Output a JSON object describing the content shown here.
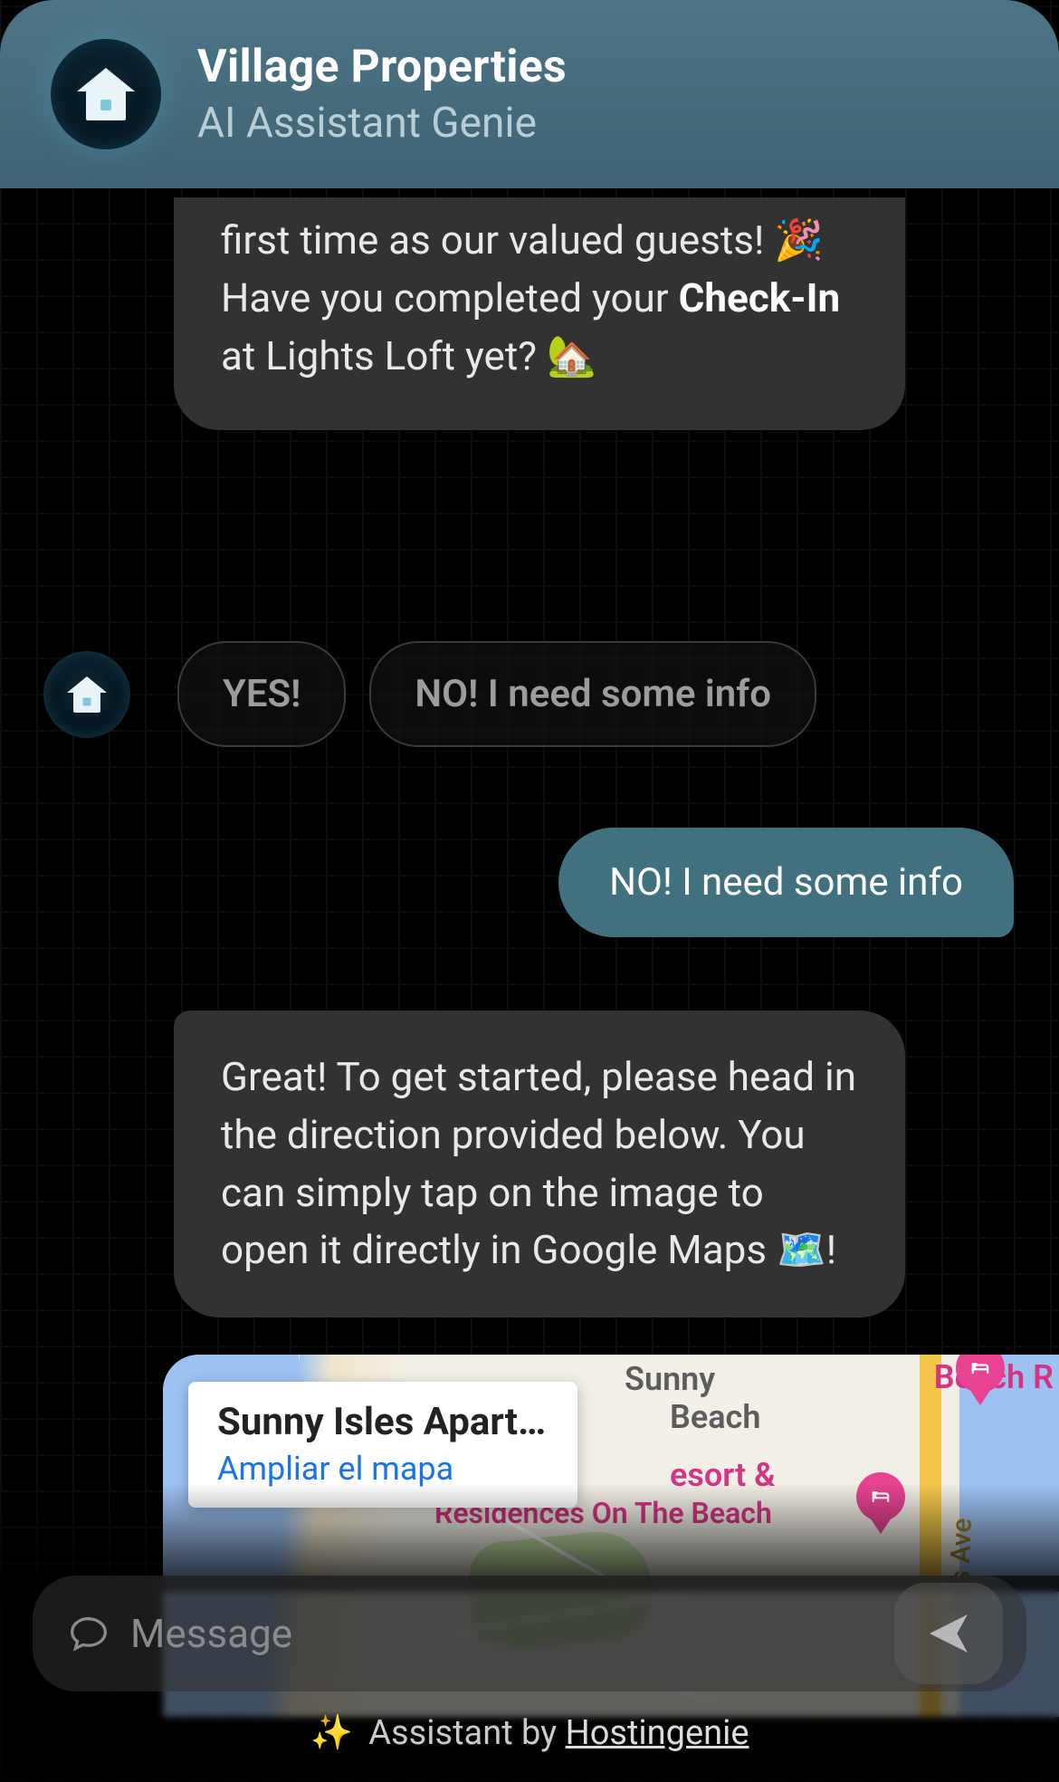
{
  "header": {
    "title": "Village Properties",
    "subtitle": "AI Assistant Genie"
  },
  "messages": {
    "bot_intro_tail_pre": "first time as our valued guests! ",
    "bot_intro_emoji1": "🎉",
    "bot_intro_q_pre": "Have you completed your ",
    "bot_intro_bold": "Check-In",
    "bot_intro_q_post": " at Lights Loft yet? ",
    "bot_intro_emoji2": "🏡",
    "quick_replies": [
      "YES!",
      "NO! I need some info"
    ],
    "user_reply": "NO! I need some info",
    "bot_directions_pre": "Great! To get started, please head in the direction provided below. You can simply tap on the image to open it directly in Google Maps ",
    "bot_directions_emoji": "🗺️",
    "bot_directions_post": "!"
  },
  "map": {
    "callout_title": "Sunny Isles Apart…",
    "callout_link": "Ampliar el mapa",
    "label_sunny": "Sunny",
    "label_beach": "Beach",
    "label_resort": "esort &",
    "label_residences": "Residences On The Beach",
    "label_beachr": "Beach R",
    "label_collins": "lins Ave"
  },
  "input": {
    "placeholder": "Message"
  },
  "footer": {
    "prefix": "Assistant by ",
    "brand": "Hostingenie",
    "spark": "✨"
  },
  "icons": {
    "avatar": "house-icon",
    "speech": "speech-bubble-icon",
    "send": "send-icon",
    "hotel": "bed-icon"
  }
}
